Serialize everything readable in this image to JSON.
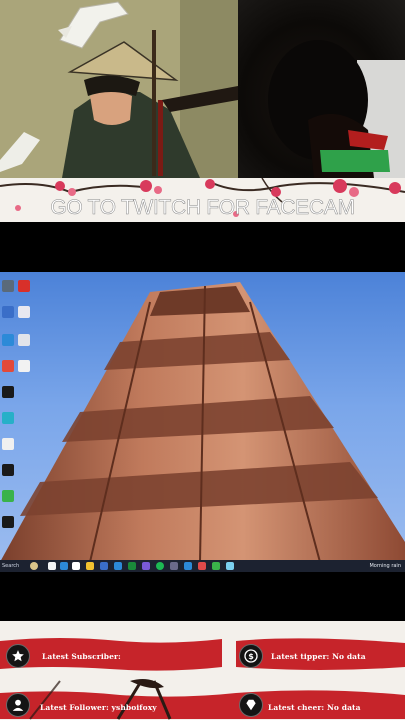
{
  "banner": {
    "text": "GO TO TWITCH FOR FACECAM"
  },
  "taskbar": {
    "search_text": "Search",
    "clock_text": "Morning rain"
  },
  "alerts": {
    "subscriber": "Latest Subscriber:",
    "tipper": "Latest tipper: No data",
    "follower": "Latest Follower: yshboifoxy",
    "cheer": "Latest cheer: No data"
  },
  "icons": {
    "subscriber": "star-icon",
    "tipper": "dollar-icon",
    "follower": "user-icon",
    "cheer": "diamond-icon"
  },
  "colors": {
    "brush_red": "#c6242a",
    "banner_blossom": "#d83a5c",
    "sky_blue": "#5a8de0",
    "tower_sandstone": "#b0634a"
  }
}
